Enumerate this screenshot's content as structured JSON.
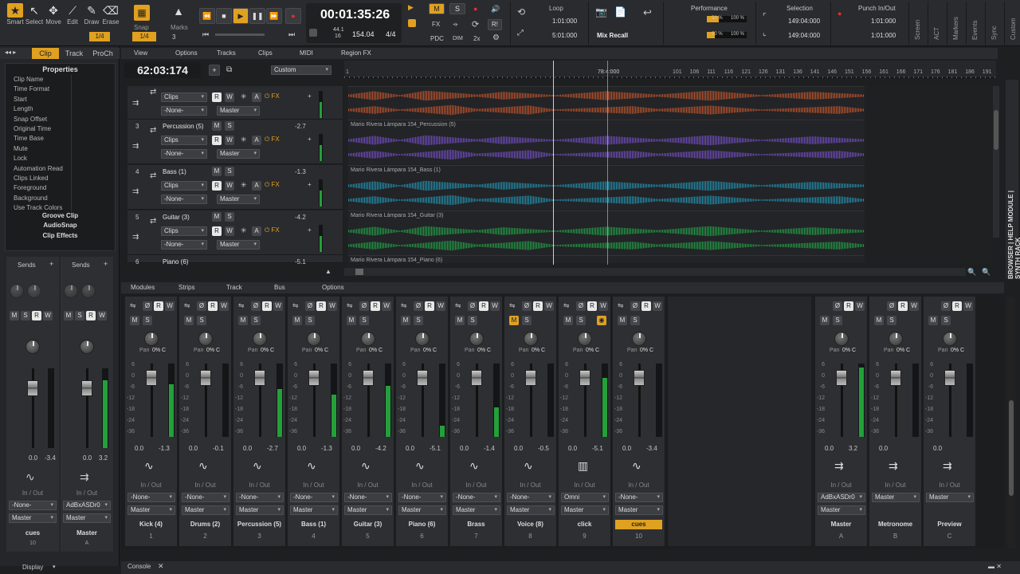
{
  "toolbar": {
    "tools": [
      {
        "label": "Smart",
        "icon": "star-icon"
      },
      {
        "label": "Select",
        "icon": "arrow-icon"
      },
      {
        "label": "Move",
        "icon": "move-icon"
      },
      {
        "label": "Edit",
        "icon": "edit-icon"
      },
      {
        "label": "Draw",
        "icon": "pencil-icon"
      },
      {
        "label": "Erase",
        "icon": "eraser-icon"
      }
    ],
    "snap_label": "Snap",
    "snap_value": "1/4",
    "snap_value2": "1/4",
    "snap_num": "3",
    "marks_label": "Marks",
    "time": "00:01:35:26",
    "sample_rate": "44.1",
    "bit_depth": "16",
    "tempo": "154.04",
    "meter": "4/4",
    "pdc": "PDC",
    "dim": "DIM",
    "fx": "FX",
    "speed": "2x",
    "m_btn": "M",
    "s_btn": "S",
    "r_btn": "R!",
    "loop_label": "Loop",
    "loop_start": "1:01:000",
    "loop_end": "5:01:000",
    "mix_recall": "Mix Recall",
    "performance_label": "Performance",
    "perf_1": "50 %",
    "perf_2": "100 %",
    "perf_3": "50 %",
    "perf_4": "100 %",
    "selection_label": "Selection",
    "selection_start": "149:04:000",
    "selection_end": "149:04:000",
    "punch_label": "Punch In/Out",
    "punch_start": "1:01:000",
    "punch_end": "1:01:000",
    "side_tabs": [
      "Screen",
      "ACT",
      "Markers",
      "Events",
      "Sync",
      "Custom"
    ]
  },
  "inspector": {
    "tabs": [
      "Clip",
      "Track",
      "ProCh"
    ],
    "header": "Properties",
    "items": [
      "Clip Name",
      "Time Format",
      "Start",
      "Length",
      "Snap Offset",
      "Original Time",
      "Time Base",
      "Mute",
      "Lock",
      "Automation Read",
      "Clips Linked",
      "Foreground",
      "Background",
      "Use Track Colors"
    ],
    "sections": [
      "Groove Clip",
      "AudioSnap",
      "Clip Effects"
    ]
  },
  "track_view": {
    "menus": [
      "View",
      "Options",
      "Tracks",
      "Clips",
      "MIDI",
      "Region FX"
    ],
    "now_time": "62:03:174",
    "view_preset": "Custom",
    "ruler_start": "1",
    "ruler_marker": "78:4:000",
    "ruler_ticks": [
      "101",
      "106",
      "111",
      "116",
      "121",
      "126",
      "131",
      "136",
      "141",
      "146",
      "151",
      "156",
      "161",
      "166",
      "171",
      "176",
      "181",
      "186",
      "191"
    ],
    "tracks": [
      {
        "num": "",
        "name": "",
        "gain": "",
        "clips_label": "Clips",
        "input": "-None-",
        "output": "Master",
        "clip_name": "",
        "color": "#d45a2a"
      },
      {
        "num": "3",
        "name": "Percussion (5)",
        "gain": "-2.7",
        "clips_label": "Clips",
        "input": "-None-",
        "output": "Master",
        "clip_name": "Mario Rivera Lámpara 154_Percussion (5)",
        "color": "#7a52d4"
      },
      {
        "num": "4",
        "name": "Bass (1)",
        "gain": "-1.3",
        "clips_label": "Clips",
        "input": "-None-",
        "output": "Master",
        "clip_name": "Mario Rivera Lámpara 154_Bass (1)",
        "color": "#1f9ec2"
      },
      {
        "num": "5",
        "name": "Guitar (3)",
        "gain": "-4.2",
        "clips_label": "Clips",
        "input": "-None-",
        "output": "Master",
        "clip_name": "Mario Rivera Lámpara 154_Guitar (3)",
        "color": "#1fb04a"
      },
      {
        "num": "6",
        "name": "Piano (6)",
        "gain": "-5.1",
        "clips_label": "",
        "input": "",
        "output": "",
        "clip_name": "Mario Rivera Lámpara 154_Piano (6)",
        "color": "#cccc33"
      }
    ],
    "browser_tabs": "BROWSER | HELP MODULE | SYNTH RACK"
  },
  "console": {
    "menus": [
      "Modules",
      "Strips",
      "Track",
      "Bus",
      "Options"
    ],
    "left_strips": [
      {
        "name": "cues",
        "num": "10",
        "route": "-None-",
        "out": "Master",
        "left": "0.0",
        "right": "-3.4",
        "sends": "Sends"
      },
      {
        "name": "Master",
        "num": "A",
        "route": "AdBxASDr0",
        "out": "Master",
        "left": "0.0",
        "right": "3.2",
        "sends": "Sends"
      }
    ],
    "strips": [
      {
        "name": "Kick (4)",
        "num": "1",
        "route": "-None-",
        "out": "Master",
        "pan": "Pan",
        "pan_val": "0% C",
        "fader": "0.0",
        "peak": "-1.3",
        "level": 0.72
      },
      {
        "name": "Drums (2)",
        "num": "2",
        "route": "-None-",
        "out": "Master",
        "pan": "Pan",
        "pan_val": "0% C",
        "fader": "0.0",
        "peak": "-0.1",
        "level": 0.0
      },
      {
        "name": "Percussion (5)",
        "num": "3",
        "route": "-None-",
        "out": "Master",
        "pan": "Pan",
        "pan_val": "0% C",
        "fader": "0.0",
        "peak": "-2.7",
        "level": 0.65
      },
      {
        "name": "Bass (1)",
        "num": "4",
        "route": "-None-",
        "out": "Master",
        "pan": "Pan",
        "pan_val": "0% C",
        "fader": "0.0",
        "peak": "-1.3",
        "level": 0.58
      },
      {
        "name": "Guitar (3)",
        "num": "5",
        "route": "-None-",
        "out": "Master",
        "pan": "Pan",
        "pan_val": "0% C",
        "fader": "0.0",
        "peak": "-4.2",
        "level": 0.7
      },
      {
        "name": "Piano (6)",
        "num": "6",
        "route": "-None-",
        "out": "Master",
        "pan": "Pan",
        "pan_val": "0% C",
        "fader": "0.0",
        "peak": "-5.1",
        "level": 0.15
      },
      {
        "name": "Brass",
        "num": "7",
        "route": "-None-",
        "out": "Master",
        "pan": "Pan",
        "pan_val": "0% C",
        "fader": "0.0",
        "peak": "-1.4",
        "level": 0.4
      },
      {
        "name": "Voice (8)",
        "num": "8",
        "route": "-None-",
        "out": "Master",
        "pan": "Pan",
        "pan_val": "0% C",
        "fader": "0.0",
        "peak": "-0.5",
        "level": 0.0
      },
      {
        "name": "click",
        "num": "9",
        "route": "Omni",
        "out": "Master",
        "pan": "Pan",
        "pan_val": "0% C",
        "fader": "0.0",
        "peak": "-5.1",
        "level": 0.8
      },
      {
        "name": "cues",
        "num": "10",
        "route": "-None-",
        "out": "Master",
        "pan": "Pan",
        "pan_val": "0% C",
        "fader": "0.0",
        "peak": "-3.4",
        "level": 0.0
      }
    ],
    "bus_strips": [
      {
        "name": "Master",
        "num": "A",
        "route": "AdBxASDr0",
        "out": "Master",
        "pan": "Pan",
        "pan_val": "0% C",
        "fader": "0.0",
        "peak": "3.2",
        "level": 0.95
      },
      {
        "name": "Metronome",
        "num": "B",
        "route": "Master",
        "out": "",
        "pan": "Pan",
        "pan_val": "0% C",
        "fader": "0.0",
        "peak": "",
        "level": 0.0
      },
      {
        "name": "Preview",
        "num": "C",
        "route": "Master",
        "out": "",
        "pan": "Pan",
        "pan_val": "0% C",
        "fader": "0.0",
        "peak": "",
        "level": 0.0
      }
    ],
    "in_out": "In / Out",
    "scale": [
      "6",
      "0",
      "-6",
      "-12",
      "-18",
      "-24",
      "-36"
    ],
    "meter_scale": [
      "3",
      "-6",
      "-12",
      "-18",
      "-24",
      "-30",
      "-36",
      "-42",
      "-48",
      "-54",
      "-60"
    ]
  },
  "bottom": {
    "display": "Display",
    "console_tab": "Console"
  }
}
